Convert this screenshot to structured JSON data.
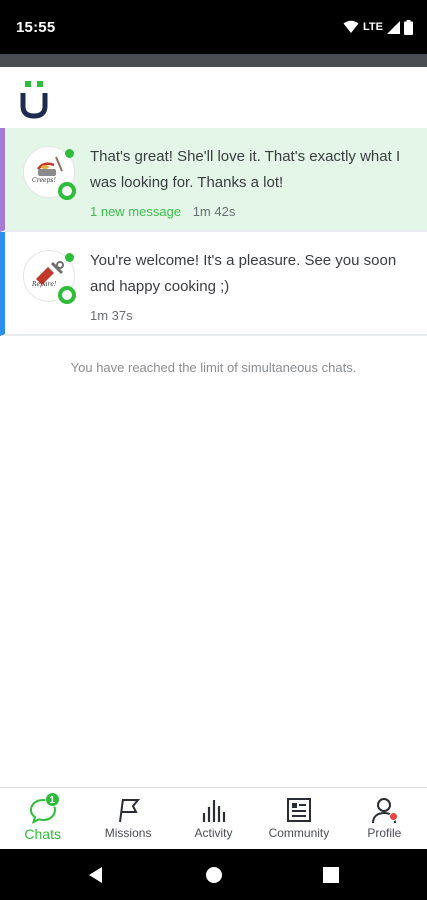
{
  "status_bar": {
    "time": "15:55",
    "network": "LTE"
  },
  "chats": [
    {
      "message": "That's great! She'll love it. That's exactly what I was looking for. Thanks a lot!",
      "new_label": "1 new message",
      "time": "1m 42s",
      "avatar_caption": "Creeps!"
    },
    {
      "message": "You're welcome! It's a pleasure. See you soon and happy cooking ;)",
      "new_label": "",
      "time": "1m 37s",
      "avatar_caption": "Repare!"
    }
  ],
  "limit_note": "You have reached the limit of simultaneous chats.",
  "bottom_nav": {
    "chats": {
      "label": "Chats",
      "badge": "1"
    },
    "missions": {
      "label": "Missions"
    },
    "activity": {
      "label": "Activity"
    },
    "community": {
      "label": "Community"
    },
    "profile": {
      "label": "Profile"
    }
  },
  "colors": {
    "brand_green": "#2ebd3a",
    "brand_navy": "#1d2b4f",
    "selected_chat_bg": "#e3f6e7",
    "chat1_accent": "#a57bd5",
    "chat2_accent": "#2f8ff0",
    "notification_red": "#e94343"
  },
  "icons": {
    "status": [
      "wifi-icon",
      "signal-icon",
      "battery-icon"
    ],
    "nav": [
      "chat-bubble-icon",
      "flag-icon",
      "bar-chart-icon",
      "news-icon",
      "person-icon"
    ],
    "system": [
      "back-icon",
      "home-icon",
      "recents-icon"
    ]
  }
}
